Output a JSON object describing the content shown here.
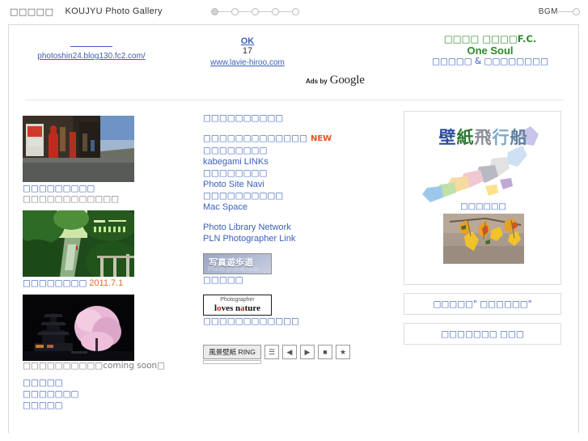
{
  "header": {
    "site_mark": "□□□□□",
    "site_title": "KOUJYU Photo Gallery",
    "step_dots": 5,
    "bgm_label": "BGM"
  },
  "ads": {
    "label": "Ads by",
    "brand": "Google",
    "items": [
      {
        "title": "",
        "line": "",
        "url": "photoshin24.blog130.fc2.com/"
      },
      {
        "title": "OK",
        "line": "17",
        "url": "www.lavie-hiroo.com"
      }
    ],
    "promo": {
      "line1": "□□□□ □□□□F.C.",
      "line2": "One Soul",
      "line3": "□□□□□ & □□□□□□□□"
    }
  },
  "left_column": {
    "photos": [
      {
        "alt": "street-with-red-mailbox",
        "caption": "□□□□□□□□□",
        "subcaption": "□□□□□□□□□□□□"
      },
      {
        "alt": "green-valley-calendar",
        "caption": "□□□□□□□□",
        "date": "2011.7.1",
        "subcaption": ""
      },
      {
        "alt": "castle-night-cherry-blossom",
        "caption": "",
        "subcaption": "□□□□□□□□□□coming soon□"
      }
    ],
    "bottom_links": [
      "□□□□□",
      "□□□□□□□",
      "□□□□□"
    ]
  },
  "center_column": {
    "heading": "□□□□□□□□□□",
    "link_groups": [
      {
        "jp": "□□□□□□□□□□□□□",
        "badge": "NEW",
        "en": ""
      },
      {
        "jp": "□□□□□□□□",
        "en": "kabegami LINKs"
      },
      {
        "jp": "□□□□□□□□",
        "en": "Photo Site Navi"
      },
      {
        "jp": "□□□□□□□□□□",
        "en": "Mac Space"
      }
    ],
    "plain_links": [
      "Photo Library Network",
      "PLN Photographer Link"
    ],
    "banner_promenade": {
      "jp": "写真遊歩道",
      "en": "Photo promenade",
      "caption": "□□□□□"
    },
    "banner_loves_nature": {
      "top": "Photographer",
      "main_1": "l",
      "main_o": "o",
      "main_2": "ves n",
      "main_a": "a",
      "main_3": "ture",
      "caption": "□□□□□□□□□□□□"
    },
    "ring": {
      "label": "風景壁紙 RING",
      "buttons": [
        "list-icon",
        "prev-icon",
        "next-icon",
        "stop-icon",
        "star-icon"
      ],
      "glyphs": [
        "☰",
        "◀",
        "▶",
        "■",
        "★"
      ]
    }
  },
  "right_column": {
    "wallpaper_box": {
      "kanji": [
        "壁",
        "紙",
        "飛",
        "行",
        "船"
      ],
      "map_link": "□□□□□□",
      "leaf_alt": "autumn-maple-leaves"
    },
    "link_boxes": [
      "□□□□□\" □□□□□□\"",
      "□□□□□□□ □□□"
    ]
  },
  "colors": {
    "link": "#3a60b8",
    "accent_new": "#e8531f",
    "accent_date": "#e06a2b",
    "ad_green": "#2a8a2a",
    "border": "#d9d9d9"
  }
}
